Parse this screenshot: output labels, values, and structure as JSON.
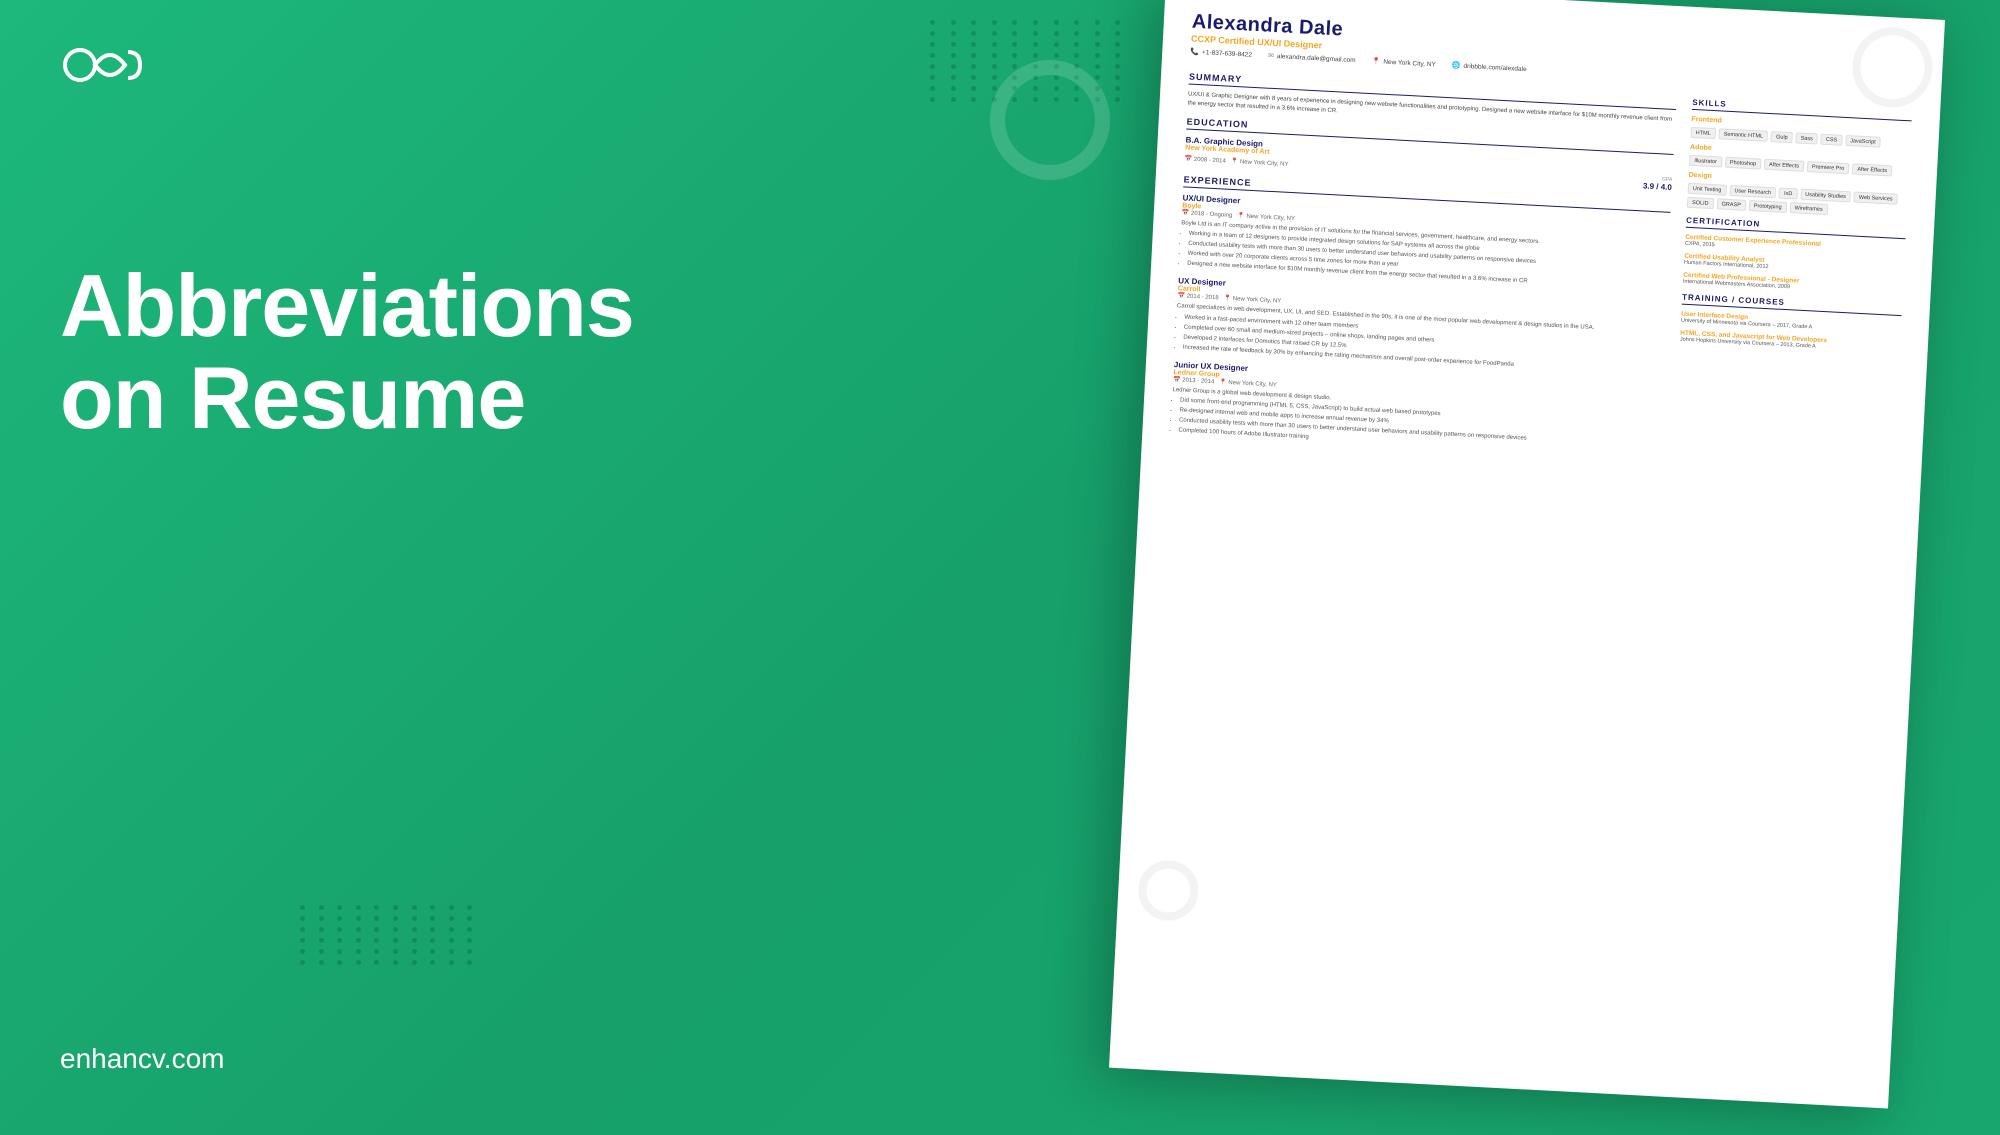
{
  "logo": {
    "alt": "Enhancv logo"
  },
  "title_line1": "Abbreviations",
  "title_line2": "on Resume",
  "website": "enhancv.com",
  "resume": {
    "name": "Alexandra Dale",
    "job_title": "CCXP Certified UX/UI Designer",
    "phone": "+1-837-639-8422",
    "email": "alexandra.dale@gmail.com",
    "location": "New York City, NY",
    "portfolio": "dribbble.com/alexdale",
    "summary": {
      "heading": "SUMMARY",
      "text": "UX/UI & Graphic Designer with 8 years of experience in designing new website functionalities and prototyping. Designed a new website interface for $10M monthly revenue client from the energy sector that resulted in a 3.6% increase in CR."
    },
    "education": {
      "heading": "EDUCATION",
      "items": [
        {
          "degree": "B.A. Graphic Design",
          "school": "New York Academy of Art",
          "dates": "2008 - 2014",
          "location": "New York City, NY",
          "gpa_label": "GPA",
          "gpa": "3.9 / 4.0"
        }
      ]
    },
    "experience": {
      "heading": "EXPERIENCE",
      "items": [
        {
          "title": "UX/UI Designer",
          "company": "Boyle",
          "dates": "2018 - Ongoing",
          "location": "New York City, NY",
          "description": "Boyle Ltd is an IT company active in the provision of IT solutions for the financial services, government, healthcare, and energy sectors.",
          "bullets": [
            "Working in a team of 12 designers to provide integrated design solutions for SAP systems all across the globe",
            "Conducted usability tests with more than 30 users to better understand user behaviors and usability patterns on responsive devices",
            "Worked with over 20 corporate clients across 5 time zones for more than a year",
            "Designed a new website interface for $10M monthly revenue client from the energy sector that resulted in a 3.6% increase in CR"
          ]
        },
        {
          "title": "UX Designer",
          "company": "Carroll",
          "dates": "2014 - 2018",
          "location": "New York City, NY",
          "description": "Carroll specializes in web development, UX, UI, and SEO. Established in the 90s, it is one of the most popular web development & design studios in the USA.",
          "bullets": [
            "Worked in a fast-paced environment with 12 other team members",
            "Completed over 60 small and medium-sized projects – online shops, landing pages and others",
            "Developed 2 interfaces for Domotics that raised CR by 12.5%",
            "Increased the rate of feedback by 30% by enhancing the rating mechanism and overall post-order experience for FoodPanda"
          ]
        },
        {
          "title": "Junior UX Designer",
          "company": "Ledner Group",
          "dates": "2013 - 2014",
          "location": "New York City, NY",
          "description": "Ledner Group is a global web development & design studio.",
          "bullets": [
            "Did some front-end programming (HTML 5, CSS, JavaScript) to build actual web based prototypes",
            "Re-designed internal web and mobile apps to increase annual revenue by 34%",
            "Conducted usability tests with more than 30 users to better understand user behaviors and usability patterns on responsive devices",
            "Completed 100 hours of Adobe Illustrator training"
          ]
        }
      ]
    },
    "skills": {
      "heading": "SKILLS",
      "categories": [
        {
          "name": "Frontend",
          "tags": [
            "HTML",
            "Semantic HTML",
            "Gulp",
            "Sass",
            "CSS",
            "JavaScript"
          ]
        },
        {
          "name": "Adobe",
          "tags": [
            "Illustrator",
            "Photoshop",
            "After Effects",
            "Premiere Pro",
            "After Effects"
          ]
        },
        {
          "name": "Design",
          "tags": [
            "Unit Testing",
            "User Research",
            "IxD",
            "Usability Studies",
            "Web Services",
            "SOLID",
            "GRASP",
            "Prototyping",
            "Wireframes"
          ]
        }
      ]
    },
    "certification": {
      "heading": "CERTIFICATION",
      "items": [
        {
          "title": "Certified Customer Experience Professional",
          "org": "CXPA, 2015"
        },
        {
          "title": "Certified Usability Analyst",
          "org": "Human Factors International, 2012"
        },
        {
          "title": "Certified Web Professional - Designer",
          "org": "International Webmasters Association, 2009"
        }
      ]
    },
    "training": {
      "heading": "TRAINING / COURSES",
      "items": [
        {
          "title": "User Interface Design",
          "org": "University of Minnesota via Coursera – 2017, Grade A"
        },
        {
          "title": "HTML, CSS, and Javascript for Web Developers",
          "org": "Johns Hopkins University via Coursera – 2013, Grade A"
        }
      ]
    }
  }
}
